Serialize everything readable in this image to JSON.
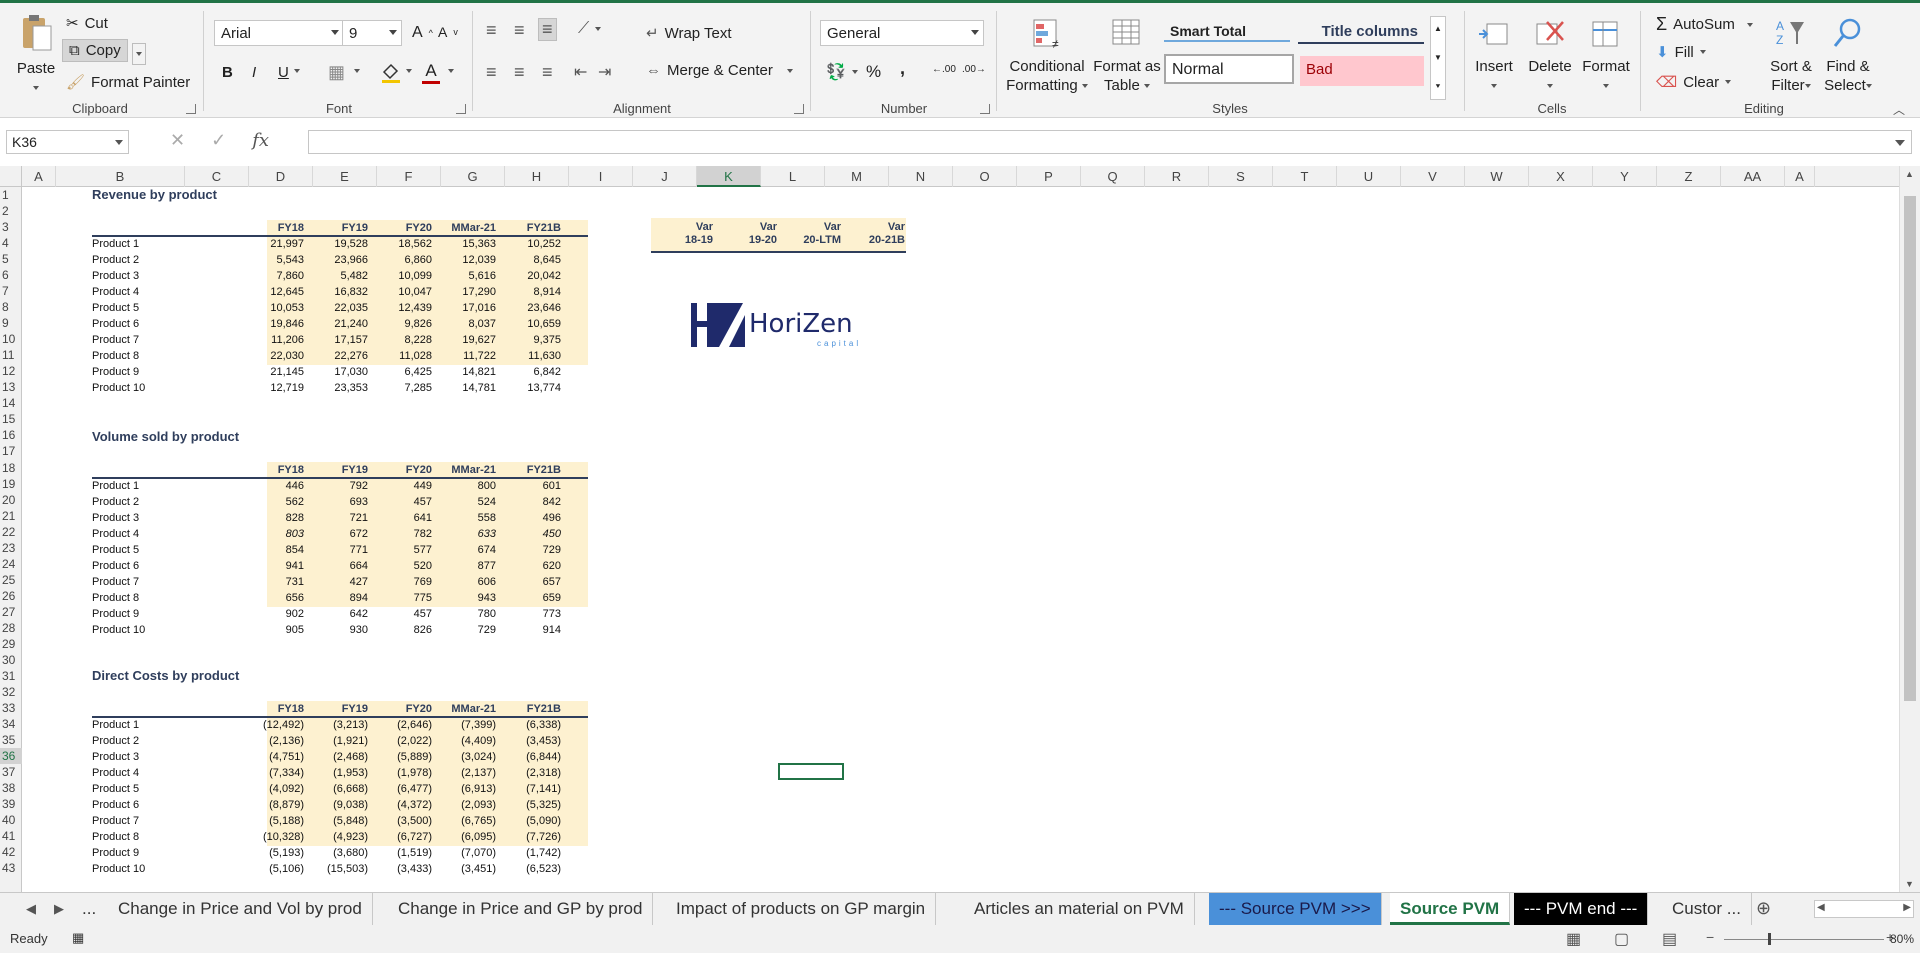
{
  "clipboard": {
    "paste": "Paste",
    "cut": "Cut",
    "copy": "Copy",
    "format_painter": "Format Painter",
    "label": "Clipboard"
  },
  "font": {
    "name": "Arial",
    "size": "9",
    "label": "Font",
    "bold": "B",
    "italic": "I",
    "underline": "U",
    "color_letter": "A"
  },
  "alignment": {
    "wrap_text": "Wrap Text",
    "merge_center": "Merge & Center",
    "label": "Alignment"
  },
  "number": {
    "format": "General",
    "label": "Number",
    "percent": "%",
    "comma": ","
  },
  "styles": {
    "conditional": "Conditional",
    "formatting": "Formatting",
    "format_as": "Format as",
    "table": "Table",
    "smart_total": "Smart Total",
    "title_columns": "Title columns",
    "normal": "Normal",
    "bad": "Bad",
    "label": "Styles"
  },
  "cells": {
    "insert": "Insert",
    "delete": "Delete",
    "format": "Format",
    "label": "Cells"
  },
  "editing": {
    "autosum": "AutoSum",
    "fill": "Fill",
    "clear": "Clear",
    "sort_filter_1": "Sort &",
    "sort_filter_2": "Filter",
    "find_select_1": "Find &",
    "find_select_2": "Select",
    "label": "Editing"
  },
  "formula_bar": {
    "name_box": "K36",
    "fx": "fx",
    "value": ""
  },
  "columns": [
    "A",
    "B",
    "C",
    "D",
    "E",
    "F",
    "G",
    "H",
    "I",
    "J",
    "K",
    "L",
    "M",
    "N",
    "O",
    "P",
    "Q",
    "R",
    "S",
    "T",
    "U",
    "V",
    "W",
    "X",
    "Y",
    "Z",
    "AA",
    "A"
  ],
  "rows": [
    "1",
    "2",
    "3",
    "4",
    "5",
    "6",
    "7",
    "8",
    "9",
    "10",
    "11",
    "12",
    "13",
    "14",
    "15",
    "16",
    "17",
    "18",
    "19",
    "20",
    "21",
    "22",
    "23",
    "24",
    "25",
    "26",
    "27",
    "28",
    "29",
    "30",
    "31",
    "32",
    "33",
    "34",
    "35",
    "36",
    "37",
    "38",
    "39",
    "40",
    "41",
    "42",
    "43"
  ],
  "selected": {
    "col": "K",
    "row": "36"
  },
  "periods": [
    "FY18",
    "FY19",
    "FY20",
    "MMar-21",
    "FY21B"
  ],
  "var_headers": [
    [
      "Var",
      "18-19"
    ],
    [
      "Var",
      "19-20"
    ],
    [
      "Var",
      "20-LTM"
    ],
    [
      "Var",
      "20-21B"
    ]
  ],
  "logo": {
    "text": "HoriZen",
    "sub": "capital"
  },
  "revenue": {
    "title": "Revenue by product",
    "rows": [
      {
        "label": "Product 1",
        "v": [
          "21,997",
          "19,528",
          "18,562",
          "15,363",
          "10,252"
        ]
      },
      {
        "label": "Product 2",
        "v": [
          "5,543",
          "23,966",
          "6,860",
          "12,039",
          "8,645"
        ]
      },
      {
        "label": "Product 3",
        "v": [
          "7,860",
          "5,482",
          "10,099",
          "5,616",
          "20,042"
        ]
      },
      {
        "label": "Product 4",
        "v": [
          "12,645",
          "16,832",
          "10,047",
          "17,290",
          "8,914"
        ]
      },
      {
        "label": "Product 5",
        "v": [
          "10,053",
          "22,035",
          "12,439",
          "17,016",
          "23,646"
        ]
      },
      {
        "label": "Product 6",
        "v": [
          "19,846",
          "21,240",
          "9,826",
          "8,037",
          "10,659"
        ]
      },
      {
        "label": "Product 7",
        "v": [
          "11,206",
          "17,157",
          "8,228",
          "19,627",
          "9,375"
        ]
      },
      {
        "label": "Product 8",
        "v": [
          "22,030",
          "22,276",
          "11,028",
          "11,722",
          "11,630"
        ]
      },
      {
        "label": "Product 9",
        "v": [
          "21,145",
          "17,030",
          "6,425",
          "14,821",
          "6,842"
        ]
      },
      {
        "label": "Product 10",
        "v": [
          "12,719",
          "23,353",
          "7,285",
          "14,781",
          "13,774"
        ]
      }
    ]
  },
  "volume": {
    "title": "Volume sold by product",
    "rows": [
      {
        "label": "Product 1",
        "v": [
          "446",
          "792",
          "449",
          "800",
          "601"
        ]
      },
      {
        "label": "Product 2",
        "v": [
          "562",
          "693",
          "457",
          "524",
          "842"
        ]
      },
      {
        "label": "Product 3",
        "v": [
          "828",
          "721",
          "641",
          "558",
          "496"
        ]
      },
      {
        "label": "Product 4",
        "v": [
          "803",
          "672",
          "782",
          "633",
          "450"
        ]
      },
      {
        "label": "Product 5",
        "v": [
          "854",
          "771",
          "577",
          "674",
          "729"
        ]
      },
      {
        "label": "Product 6",
        "v": [
          "941",
          "664",
          "520",
          "877",
          "620"
        ]
      },
      {
        "label": "Product 7",
        "v": [
          "731",
          "427",
          "769",
          "606",
          "657"
        ]
      },
      {
        "label": "Product 8",
        "v": [
          "656",
          "894",
          "775",
          "943",
          "659"
        ]
      },
      {
        "label": "Product 9",
        "v": [
          "902",
          "642",
          "457",
          "780",
          "773"
        ]
      },
      {
        "label": "Product 10",
        "v": [
          "905",
          "930",
          "826",
          "729",
          "914"
        ]
      }
    ]
  },
  "direct_costs": {
    "title": "Direct Costs by product",
    "rows": [
      {
        "label": "Product 1",
        "v": [
          "(12,492)",
          "(3,213)",
          "(2,646)",
          "(7,399)",
          "(6,338)"
        ]
      },
      {
        "label": "Product 2",
        "v": [
          "(2,136)",
          "(1,921)",
          "(2,022)",
          "(4,409)",
          "(3,453)"
        ]
      },
      {
        "label": "Product 3",
        "v": [
          "(4,751)",
          "(2,468)",
          "(5,889)",
          "(3,024)",
          "(6,844)"
        ]
      },
      {
        "label": "Product 4",
        "v": [
          "(7,334)",
          "(1,953)",
          "(1,978)",
          "(2,137)",
          "(2,318)"
        ]
      },
      {
        "label": "Product 5",
        "v": [
          "(4,092)",
          "(6,668)",
          "(6,477)",
          "(6,913)",
          "(7,141)"
        ]
      },
      {
        "label": "Product 6",
        "v": [
          "(8,879)",
          "(9,038)",
          "(4,372)",
          "(2,093)",
          "(5,325)"
        ]
      },
      {
        "label": "Product 7",
        "v": [
          "(5,188)",
          "(5,848)",
          "(3,500)",
          "(6,765)",
          "(5,090)"
        ]
      },
      {
        "label": "Product 8",
        "v": [
          "(10,328)",
          "(4,923)",
          "(6,727)",
          "(6,095)",
          "(7,726)"
        ]
      },
      {
        "label": "Product 9",
        "v": [
          "(5,193)",
          "(3,680)",
          "(1,519)",
          "(7,070)",
          "(1,742)"
        ]
      },
      {
        "label": "Product 10",
        "v": [
          "(5,106)",
          "(15,503)",
          "(3,433)",
          "(3,451)",
          "(6,523)"
        ]
      }
    ]
  },
  "sheet_tabs": [
    {
      "label": "...",
      "style": "plain"
    },
    {
      "label": "Change in Price and Vol by prod",
      "style": "plain"
    },
    {
      "label": "Change in Price and GP by prod",
      "style": "plain"
    },
    {
      "label": "Impact of products on GP margin",
      "style": "plain"
    },
    {
      "label": "Articles an material on PVM",
      "style": "plain"
    },
    {
      "label": "--- Source PVM >>>",
      "style": "blue"
    },
    {
      "label": "Source PVM",
      "style": "active"
    },
    {
      "label": "--- PVM end ---",
      "style": "black"
    },
    {
      "label": "Custor ...",
      "style": "plain"
    }
  ],
  "status": {
    "ready": "Ready",
    "zoom": "80%"
  },
  "colors": {
    "accent": "#217346",
    "yellow": "#fdf1d0",
    "navy": "#2f3e5c",
    "bad_bg": "#ffc7ce",
    "bad_fg": "#9c0006"
  }
}
